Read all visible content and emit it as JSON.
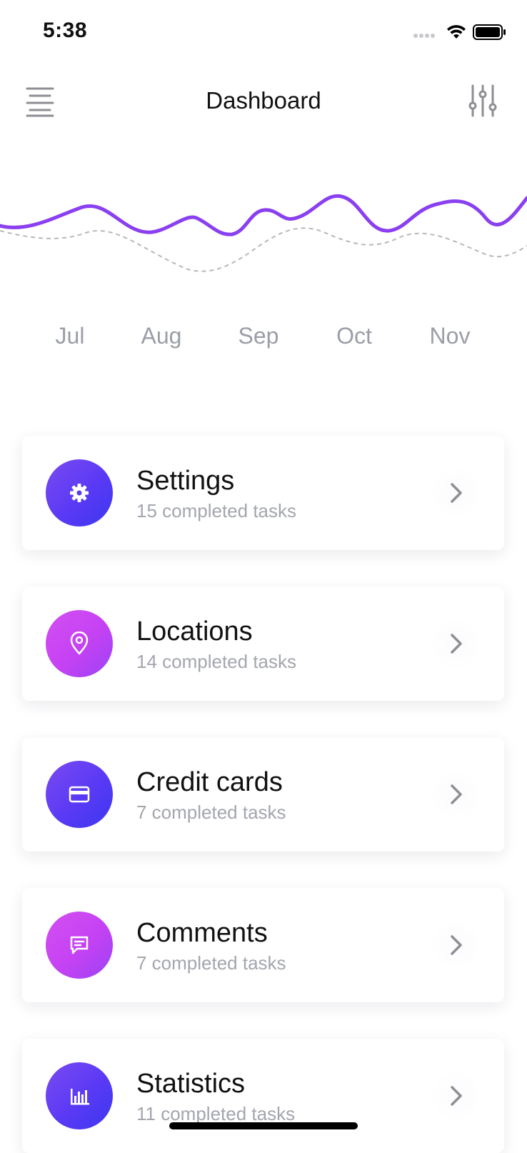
{
  "status_bar": {
    "time": "5:38"
  },
  "header": {
    "title": "Dashboard"
  },
  "chart_data": {
    "type": "line",
    "categories": [
      "Jul",
      "Aug",
      "Sep",
      "Oct",
      "Nov"
    ],
    "series": [
      {
        "style": "solid",
        "color": "#8a3ff0",
        "values": []
      },
      {
        "style": "dashed",
        "color": "#b8b8bc",
        "values": []
      }
    ],
    "grid": false,
    "legend": "none"
  },
  "cards": [
    {
      "title": "Settings",
      "subtitle": "15 completed tasks",
      "icon": "gear-icon",
      "color": "blue"
    },
    {
      "title": "Locations",
      "subtitle": "14 completed tasks",
      "icon": "location-pin-icon",
      "color": "pink"
    },
    {
      "title": "Credit cards",
      "subtitle": "7 completed tasks",
      "icon": "credit-card-icon",
      "color": "blue"
    },
    {
      "title": "Comments",
      "subtitle": "7 completed tasks",
      "icon": "comment-icon",
      "color": "pink"
    },
    {
      "title": "Statistics",
      "subtitle": "11 completed tasks",
      "icon": "bar-chart-icon",
      "color": "blue"
    }
  ],
  "colors": {
    "accent_purple": "#8a3ff0",
    "accent_blue": "#4a3af2",
    "accent_pink": "#cc48f3",
    "muted_text": "#a3a6ad"
  }
}
